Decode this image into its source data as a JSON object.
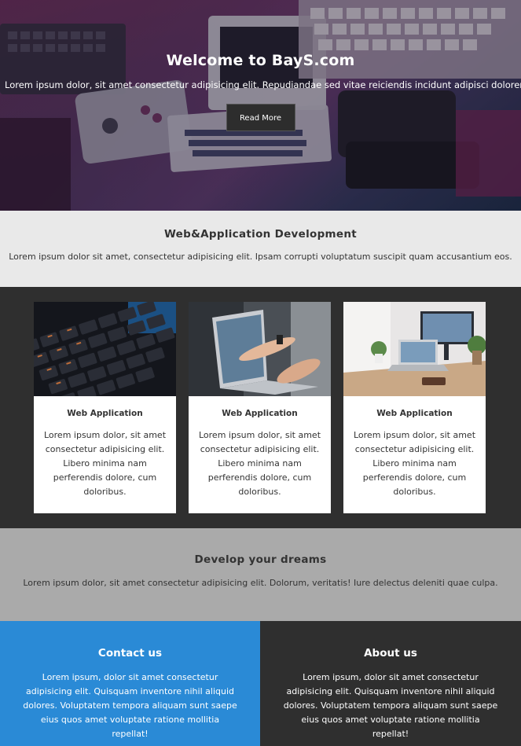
{
  "hero": {
    "title": "Welcome to BayS.com",
    "text": "Lorem ipsum dolor, sit amet consectetur adipisicing elit. Repudiandae sed vitae reiciendis incidunt adipisci dolorem.",
    "button_label": "Read More"
  },
  "services": {
    "title": "Web&Application Development",
    "text": "Lorem ipsum dolor sit amet, consectetur adipisicing elit. Ipsam corrupti voluptatum suscipit quam accusantium eos."
  },
  "cards": [
    {
      "title": "Web Application",
      "text": "Lorem ipsum dolor, sit amet consectetur adipisicing elit. Libero minima nam perferendis dolore, cum doloribus."
    },
    {
      "title": "Web Application",
      "text": "Lorem ipsum dolor, sit amet consectetur adipisicing elit. Libero minima nam perferendis dolore, cum doloribus."
    },
    {
      "title": "Web Application",
      "text": "Lorem ipsum dolor, sit amet consectetur adipisicing elit. Libero minima nam perferendis dolore, cum doloribus."
    }
  ],
  "dreams": {
    "title": "Develop your dreams",
    "text": "Lorem ipsum dolor, sit amet consectetur adipisicing elit. Dolorum, veritatis! Iure delectus deleniti quae culpa."
  },
  "footer": {
    "contact": {
      "title": "Contact us",
      "text": "Lorem ipsum, dolor sit amet consectetur adipisicing elit. Quisquam inventore nihil aliquid dolores. Voluptatem tempora aliquam sunt saepe eius quos amet voluptate ratione mollitia repellat!"
    },
    "about": {
      "title": "About us",
      "text": "Lorem ipsum, dolor sit amet consectetur adipisicing elit. Quisquam inventore nihil aliquid dolores. Voluptatem tempora aliquam sunt saepe eius quos amet voluptate ratione mollitia repellat!"
    }
  },
  "colors": {
    "hero_button": "#2d2d2d",
    "light_section": "#e9e9e9",
    "dark_section": "#2f2f2f",
    "gray_section": "#aaaaaa",
    "contact_blue": "#2a8ad6"
  },
  "images": [
    "hero-retro-computers-image",
    "keyboard-image",
    "laptop-hands-image",
    "desk-workspace-image"
  ]
}
